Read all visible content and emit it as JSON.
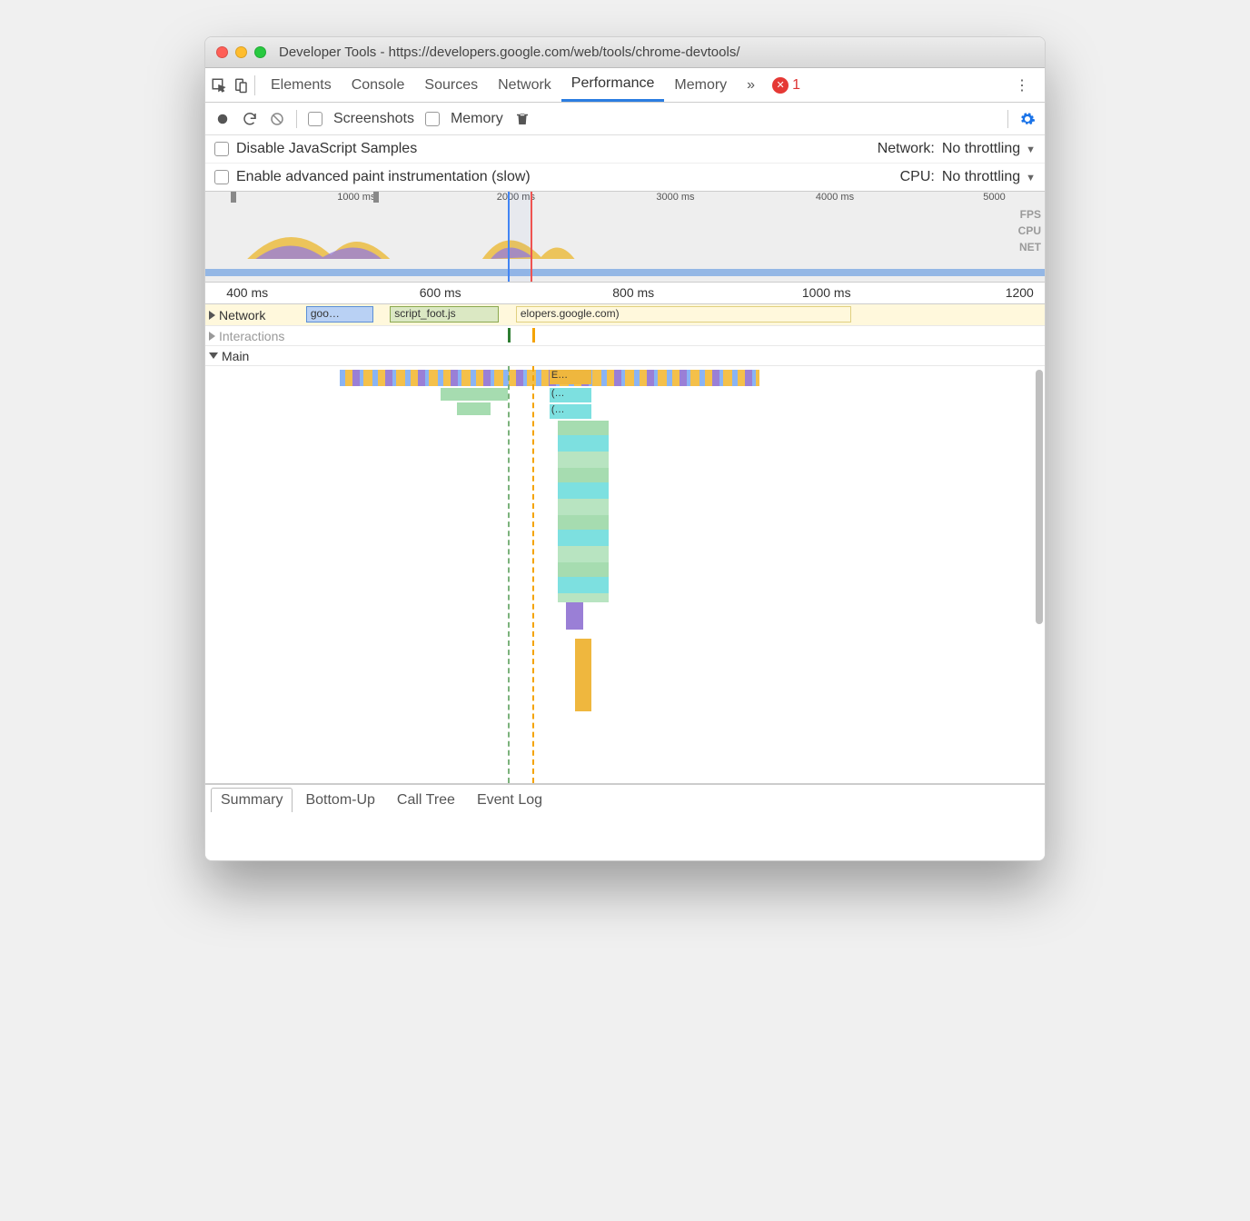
{
  "window": {
    "title": "Developer Tools - https://developers.google.com/web/tools/chrome-devtools/"
  },
  "tabs": {
    "items": [
      "Elements",
      "Console",
      "Sources",
      "Network",
      "Performance",
      "Memory"
    ],
    "active": "Performance",
    "overflow_icon": "»",
    "error_count": "1"
  },
  "toolbar": {
    "record_icon": "record",
    "reload_icon": "reload",
    "clear_icon": "clear",
    "screenshots_label": "Screenshots",
    "memory_label": "Memory",
    "trash_icon": "trash",
    "settings_icon": "gear"
  },
  "capture_settings": {
    "disable_js_label": "Disable JavaScript Samples",
    "enable_paint_label": "Enable advanced paint instrumentation (slow)",
    "network_label": "Network:",
    "network_value": "No throttling",
    "cpu_label": "CPU:",
    "cpu_value": "No throttling"
  },
  "overview": {
    "ticks": [
      {
        "label": "1000 ms",
        "pct": 18
      },
      {
        "label": "2000 ms",
        "pct": 37
      },
      {
        "label": "3000 ms",
        "pct": 56
      },
      {
        "label": "4000 ms",
        "pct": 75
      },
      {
        "label": "5000",
        "pct": 94
      }
    ],
    "lane_labels": [
      "FPS",
      "CPU",
      "NET"
    ],
    "selection": {
      "left_pct": 36,
      "right_pct": 39
    }
  },
  "flame_ruler": {
    "ticks": [
      {
        "label": "400 ms",
        "pct": 5
      },
      {
        "label": "600 ms",
        "pct": 28
      },
      {
        "label": "800 ms",
        "pct": 51
      },
      {
        "label": "1000 ms",
        "pct": 74
      },
      {
        "label": "1200",
        "pct": 97
      }
    ]
  },
  "tracks": {
    "network_label": "Network",
    "network_items": [
      {
        "label": "goo…",
        "left_pct": 12,
        "width_pct": 8,
        "cls": "blue"
      },
      {
        "label": "script_foot.js",
        "left_pct": 22,
        "width_pct": 13,
        "cls": ""
      },
      {
        "label": "elopers.google.com)",
        "left_pct": 37,
        "width_pct": 18,
        "cls": "blue"
      }
    ],
    "interactions_label": "Interactions",
    "main_label": "Main",
    "main_samples": [
      "E…",
      "(…",
      "(…"
    ]
  },
  "details_tabs": {
    "items": [
      "Summary",
      "Bottom-Up",
      "Call Tree",
      "Event Log"
    ],
    "active": "Summary"
  }
}
